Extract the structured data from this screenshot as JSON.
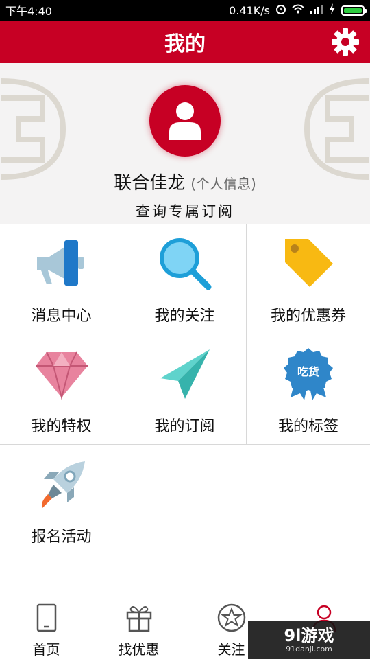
{
  "status_bar": {
    "time": "下午4:40",
    "speed": "0.41K/s",
    "icons": [
      "alarm-icon",
      "wifi-icon",
      "signal-icon",
      "charging-icon",
      "battery-icon"
    ]
  },
  "header": {
    "title": "我的",
    "settings_icon": "gear-icon"
  },
  "profile": {
    "name": "联合佳龙",
    "info_link": "(个人信息)",
    "subscribe_link": "查询专属订阅"
  },
  "menu": [
    {
      "label": "消息中心",
      "icon": "megaphone-icon"
    },
    {
      "label": "我的关注",
      "icon": "search-icon"
    },
    {
      "label": "我的优惠券",
      "icon": "tag-icon"
    },
    {
      "label": "我的特权",
      "icon": "diamond-icon"
    },
    {
      "label": "我的订阅",
      "icon": "paper-plane-icon"
    },
    {
      "label": "我的标签",
      "icon": "badge-icon",
      "badge_text": "吃货"
    },
    {
      "label": "报名活动",
      "icon": "rocket-icon"
    }
  ],
  "bottom_nav": [
    {
      "label": "首页",
      "icon": "phone-icon"
    },
    {
      "label": "找优惠",
      "icon": "gift-icon"
    },
    {
      "label": "关注",
      "icon": "star-icon"
    },
    {
      "label": "",
      "icon": "user-icon",
      "active": true
    }
  ],
  "watermark": {
    "main": "9l游戏",
    "sub": "91danji.com"
  },
  "colors": {
    "brand_red": "#c70024",
    "profile_bg": "#f4f3f3"
  }
}
